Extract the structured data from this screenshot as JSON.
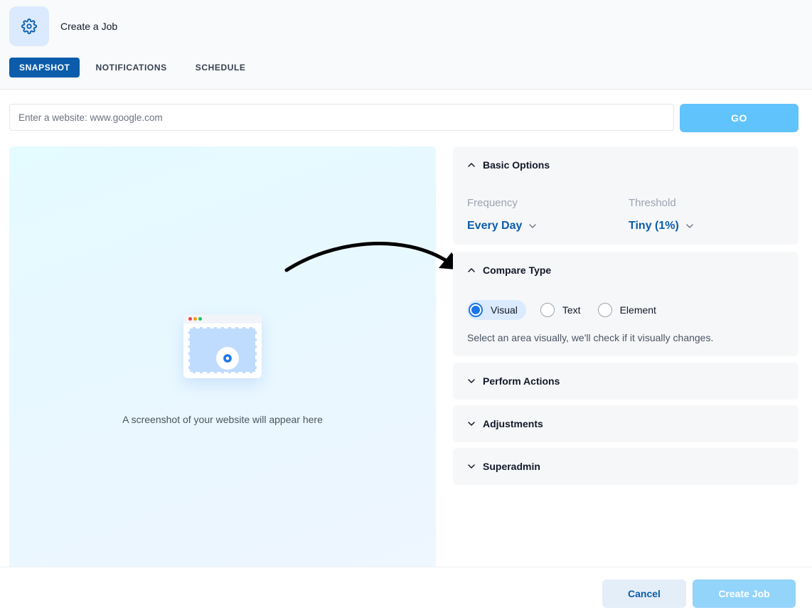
{
  "header": {
    "title": "Create a Job",
    "icon": "gear-icon",
    "tabs": [
      {
        "label": "SNAPSHOT",
        "active": true
      },
      {
        "label": "NOTIFICATIONS",
        "active": false
      },
      {
        "label": "SCHEDULE",
        "active": false
      }
    ]
  },
  "url_bar": {
    "placeholder": "Enter a website: www.google.com",
    "value": "",
    "go_label": "GO"
  },
  "preview": {
    "message": "A screenshot of your website will appear here",
    "icon": "camera-icon"
  },
  "basic_options": {
    "title": "Basic Options",
    "expanded": true,
    "frequency_label": "Frequency",
    "frequency_value": "Every Day",
    "threshold_label": "Threshold",
    "threshold_value": "Tiny (1%)"
  },
  "compare_type": {
    "title": "Compare Type",
    "expanded": true,
    "options": [
      {
        "label": "Visual",
        "selected": true
      },
      {
        "label": "Text",
        "selected": false
      },
      {
        "label": "Element",
        "selected": false
      }
    ],
    "description": "Select an area visually, we'll check if it visually changes."
  },
  "sections": [
    {
      "title": "Perform Actions",
      "expanded": false
    },
    {
      "title": "Adjustments",
      "expanded": false
    },
    {
      "title": "Superadmin",
      "expanded": false
    }
  ],
  "footer": {
    "cancel_label": "Cancel",
    "create_label": "Create Job"
  },
  "colors": {
    "primary": "#0b5cab",
    "accent": "#60c3fb",
    "radio": "#1d75e8"
  }
}
